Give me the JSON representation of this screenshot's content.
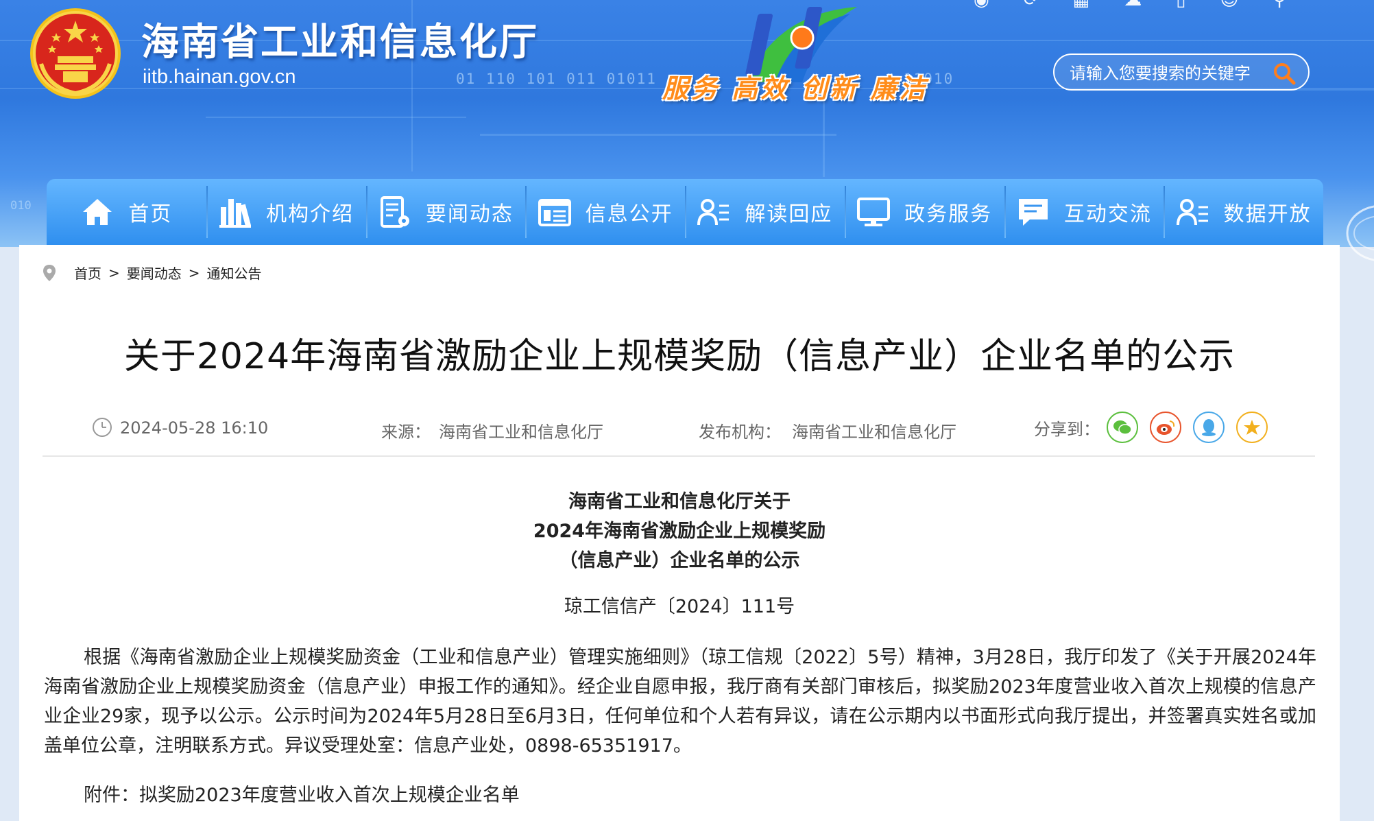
{
  "header": {
    "site_title": "海南省工业和信息化厅",
    "site_domain": "iitb.hainan.gov.cn",
    "slogan": "服务 高效 创新 廉洁",
    "binary_deco": "01  110  101  011  01011",
    "binary_deco_right": "11010",
    "binary_deco_left": "010",
    "emblem_icon": "national-emblem-icon",
    "top_icons": [
      "weibo-icon",
      "refresh-icon",
      "archive-icon",
      "chat-icon",
      "mobile-icon",
      "user-icon",
      "search-accessibility-icon"
    ]
  },
  "search": {
    "placeholder": "请输入您要搜索的关键字",
    "icon": "search-icon",
    "icon_color": "#ff7e1c"
  },
  "nav": {
    "items": [
      {
        "label": "首页",
        "icon": "home-icon"
      },
      {
        "label": "机构介绍",
        "icon": "books-icon"
      },
      {
        "label": "要闻动态",
        "icon": "news-edit-icon"
      },
      {
        "label": "信息公开",
        "icon": "document-list-icon"
      },
      {
        "label": "解读回应",
        "icon": "user-list-icon"
      },
      {
        "label": "政务服务",
        "icon": "monitor-icon"
      },
      {
        "label": "互动交流",
        "icon": "message-icon"
      },
      {
        "label": "数据开放",
        "icon": "user-data-icon"
      }
    ]
  },
  "breadcrumb": {
    "icon": "location-pin-icon",
    "items": [
      "首页",
      "要闻动态",
      "通知公告"
    ],
    "separator": ">"
  },
  "article": {
    "title": "关于2024年海南省激励企业上规模奖励（信息产业）企业名单的公示",
    "date": "2024-05-28 16:10",
    "source_label": "来源：",
    "source": "海南省工业和信息化厅",
    "publisher_label": "发布机构：",
    "publisher": "海南省工业和信息化厅",
    "share_label": "分享到：",
    "share_icons": [
      {
        "name": "wechat-share-icon",
        "color": "#5bbf3d"
      },
      {
        "name": "weibo-share-icon",
        "color": "#e8542c"
      },
      {
        "name": "qq-share-icon",
        "color": "#49a8e8"
      },
      {
        "name": "qzone-share-icon",
        "color": "#f2b01e"
      }
    ],
    "doc_heading_1": "海南省工业和信息化厅关于",
    "doc_heading_2": "2024年海南省激励企业上规模奖励",
    "doc_heading_3": "（信息产业）企业名单的公示",
    "doc_number": "琼工信信产〔2024〕111号",
    "body": "根据《海南省激励企业上规模奖励资金（工业和信息产业）管理实施细则》（琼工信规〔2022〕5号）精神，3月28日，我厅印发了《关于开展2024年海南省激励企业上规模奖励资金（信息产业）申报工作的通知》。经企业自愿申报，我厅商有关部门审核后，拟奖励2023年度营业收入首次上规模的信息产业企业29家，现予以公示。公示时间为2024年5月28日至6月3日，任何单位和个人若有异议，请在公示期内以书面形式向我厅提出，并签署真实姓名或加盖单位公章，注明联系方式。异议受理处室：信息产业处，0898-65351917。",
    "attachment": "附件：拟奖励2023年度营业收入首次上规模企业名单"
  }
}
